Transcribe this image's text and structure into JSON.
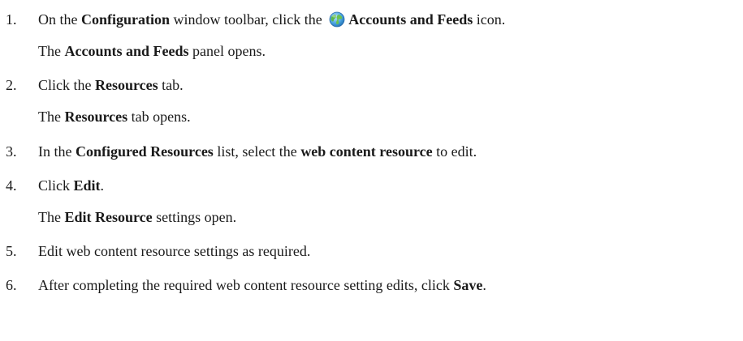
{
  "steps": [
    {
      "number": "1.",
      "pre": "On the ",
      "b1": "Configuration",
      "mid": " window toolbar, click the ",
      "icon": "globe-icon",
      "b2": "Accounts and Feeds",
      "post": " icon.",
      "result_pre": "The ",
      "result_b": "Accounts and Feeds",
      "result_post": " panel opens."
    },
    {
      "number": "2.",
      "pre": "Click the ",
      "b1": "Resources",
      "post": " tab.",
      "result_pre": "The ",
      "result_b": "Resources",
      "result_post": " tab opens."
    },
    {
      "number": "3.",
      "pre": "In the ",
      "b1": "Configured Resources",
      "mid": " list, select the ",
      "b2": "web content resource",
      "post": " to edit."
    },
    {
      "number": "4.",
      "pre": "Click ",
      "b1": "Edit",
      "post": ".",
      "result_pre": "The ",
      "result_b": "Edit Resource",
      "result_post": " settings open."
    },
    {
      "number": "5.",
      "pre": "Edit web content resource settings as required."
    },
    {
      "number": "6.",
      "pre": "After completing the required web content resource setting edits, click ",
      "b1": "Save",
      "post": "."
    }
  ]
}
